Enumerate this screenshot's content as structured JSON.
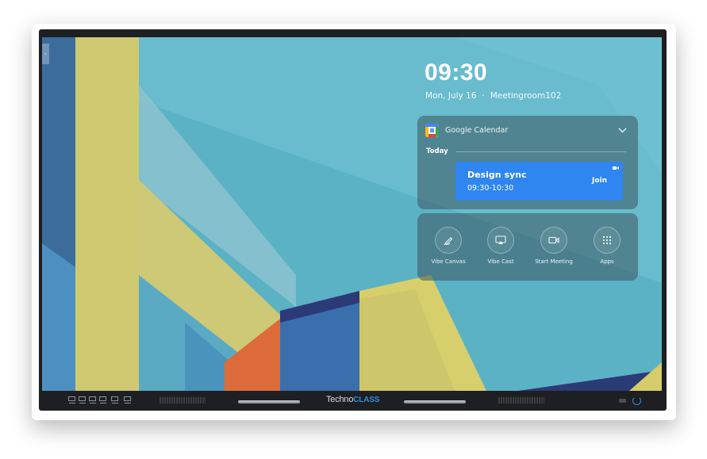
{
  "status": {
    "time": "09:30",
    "date": "Mon, July 16",
    "separator": "·",
    "room": "Meetingroom102"
  },
  "calendar": {
    "app_name": "Google Calendar",
    "section_label": "Today",
    "event": {
      "title": "Design sync",
      "time": "09:30-10:30",
      "join_label": "Join"
    }
  },
  "actions": [
    {
      "label": "Vibe Canvas",
      "icon": "pen-icon"
    },
    {
      "label": "Vibe Cast",
      "icon": "cast-icon"
    },
    {
      "label": "Start Meeting",
      "icon": "video-camera-icon"
    },
    {
      "label": "Apps",
      "icon": "grid-icon"
    }
  ],
  "hardware": {
    "brand_part1": "Techno",
    "brand_part2": "CLASS"
  },
  "colors": {
    "wallpaper_teal": "#5bb2c5",
    "event_blue": "#2f86f1",
    "accent_yellow": "#d0cb73",
    "accent_navy": "#2c3a78",
    "accent_orange": "#dd6b3a"
  }
}
